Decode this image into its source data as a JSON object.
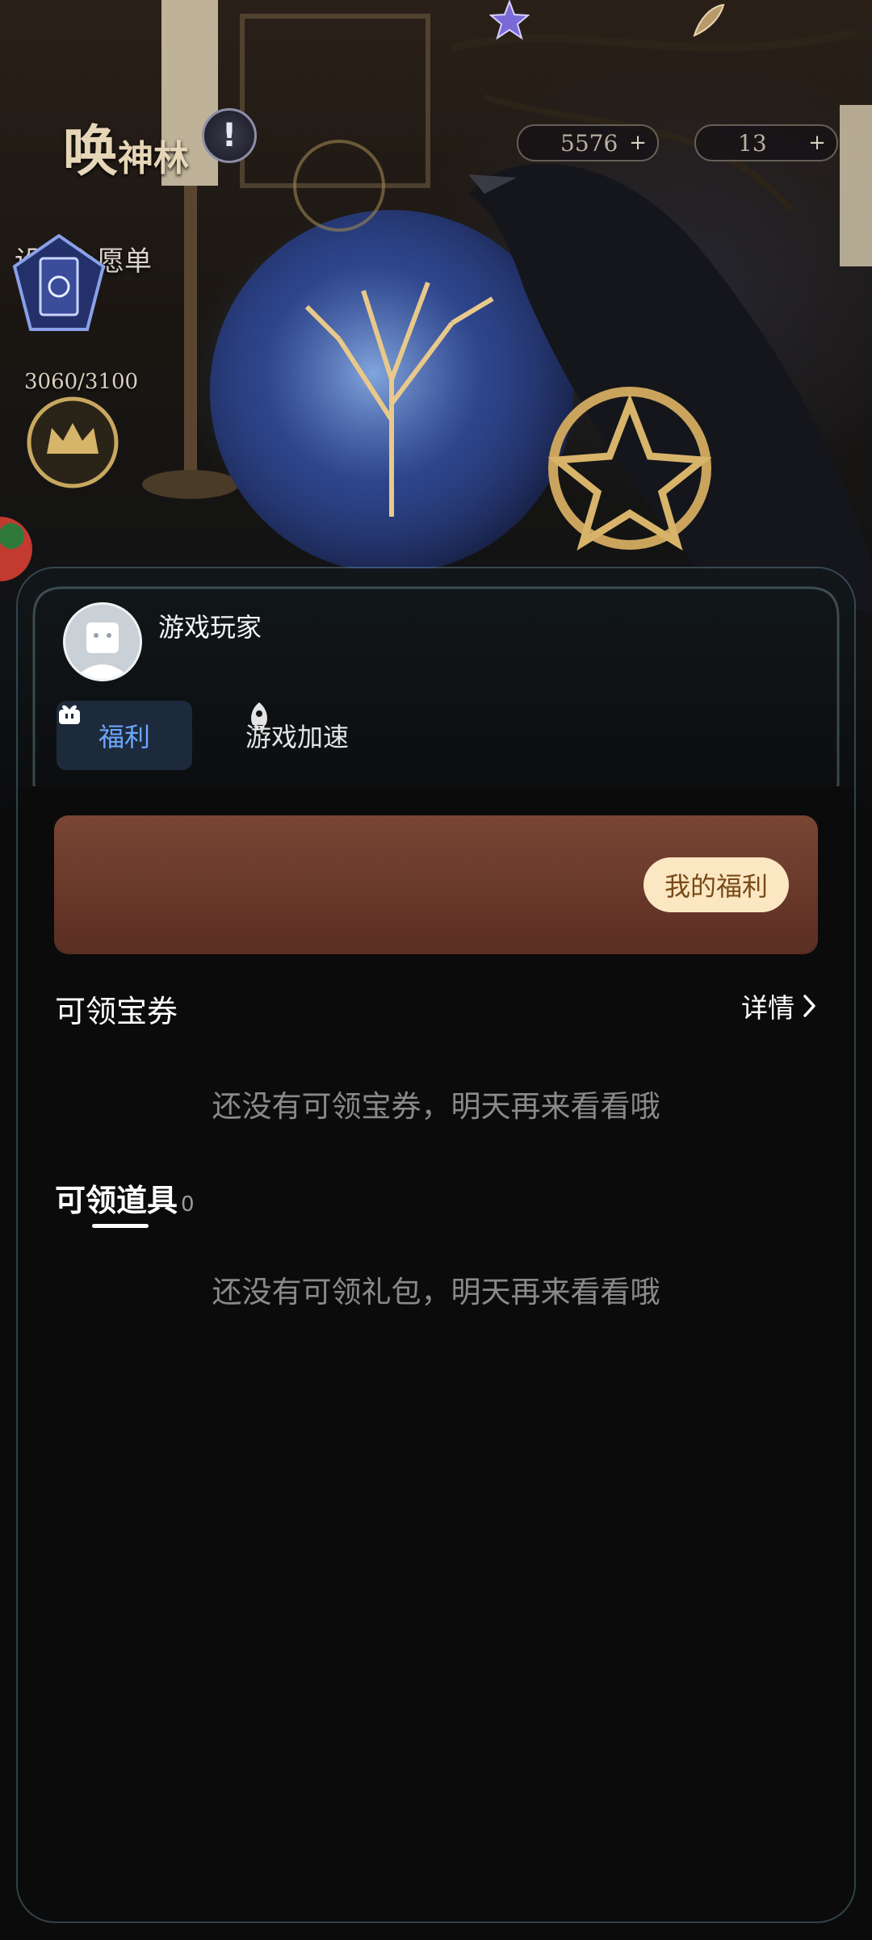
{
  "game": {
    "title_big": "唤",
    "title_small": "神林",
    "warn_symbol": "!",
    "currencies": [
      {
        "icon": "star-crystal-icon",
        "value": "5576",
        "add": "+"
      },
      {
        "icon": "feather-icon",
        "value": "13",
        "add": "+"
      }
    ],
    "wishlist_label": "设置心愿单",
    "progress_text": "3060/3100",
    "progress": {
      "current": 3060,
      "total": 3100
    }
  },
  "sheet": {
    "username": "游戏玩家",
    "tabs": [
      {
        "label": "福利",
        "icon": "gift-icon",
        "active": true
      },
      {
        "label": "游戏加速",
        "icon": "rocket-icon",
        "active": false
      }
    ],
    "banner": {
      "button_label": "我的福利"
    },
    "vouchers": {
      "title": "可领宝券",
      "details_label": "详情",
      "empty_text": "还没有可领宝券，明天再来看看哦"
    },
    "props": {
      "title": "可领道具",
      "count": "0",
      "empty_text": "还没有可领礼包，明天再来看看哦"
    }
  },
  "colors": {
    "active_tab_text": "#6da7ff",
    "active_tab_bg": "#1d2a3c",
    "banner_top": "#7a4634",
    "banner_bottom": "#5a2e22",
    "pill_bg": "#fbe7c2",
    "pill_text": "#7a4a18",
    "sheet_bg": "#0b0b0b"
  }
}
